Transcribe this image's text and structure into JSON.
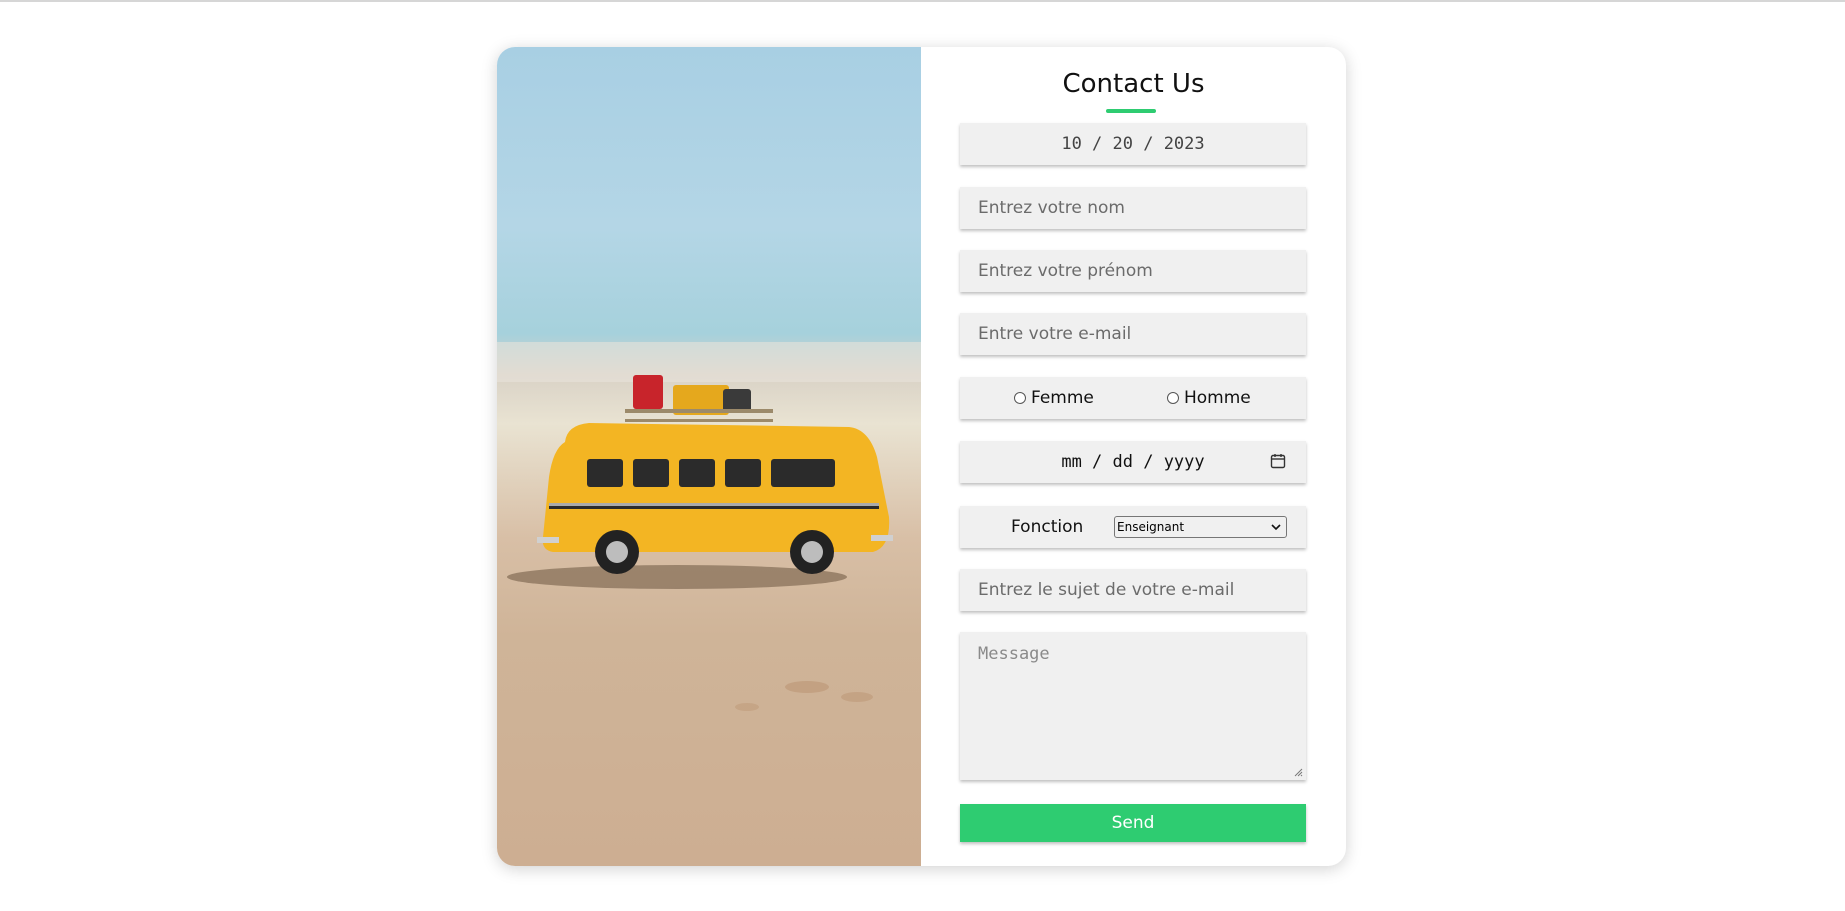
{
  "contact": {
    "title": "Contact Us",
    "date_value": "10 / 20 / 2023",
    "nom_placeholder": "Entrez votre nom",
    "prenom_placeholder": "Entrez votre prénom",
    "email_placeholder": "Entre votre e-mail",
    "gender": {
      "options": [
        "Femme",
        "Homme"
      ],
      "selected": null
    },
    "birthdate_value": "mm / dd / yyyy",
    "fonction_label": "Fonction",
    "fonction_selected": "Enseignant",
    "subject_placeholder": "Entrez le sujet de votre e-mail",
    "message_placeholder": "Message",
    "send_label": "Send"
  },
  "theme": {
    "accent": "#2ecc71",
    "field_bg": "#f0f0f0",
    "card_bg": "#ffffff"
  },
  "photo": {
    "description_icon": "toy-van-on-beach-image"
  }
}
